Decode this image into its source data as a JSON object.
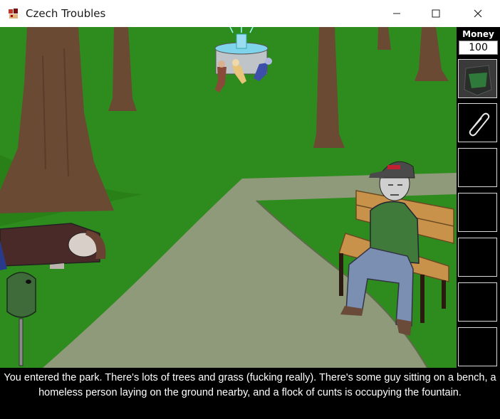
{
  "window": {
    "title": "Czech Troubles",
    "icon": "game-app-icon"
  },
  "sidebar": {
    "money_label": "Money",
    "money_value": "100",
    "inventory": [
      {
        "name": "jacket",
        "icon": "dark-jacket-icon"
      },
      {
        "name": "paperclip",
        "icon": "paperclip-icon"
      },
      {
        "name": "empty"
      },
      {
        "name": "empty"
      },
      {
        "name": "empty"
      },
      {
        "name": "empty"
      },
      {
        "name": "empty"
      }
    ]
  },
  "scene": {
    "location": "park"
  },
  "narration": "You entered the park. There's lots of trees and grass (fucking really). There's some guy sitting on a bench, a homeless person laying on the ground nearby, and a flock of cunts is occupying the fountain.",
  "colors": {
    "grass": "#2e8b1e",
    "path": "#8f9a7a",
    "trunk": "#6b4a34",
    "textbar": "#000000"
  }
}
